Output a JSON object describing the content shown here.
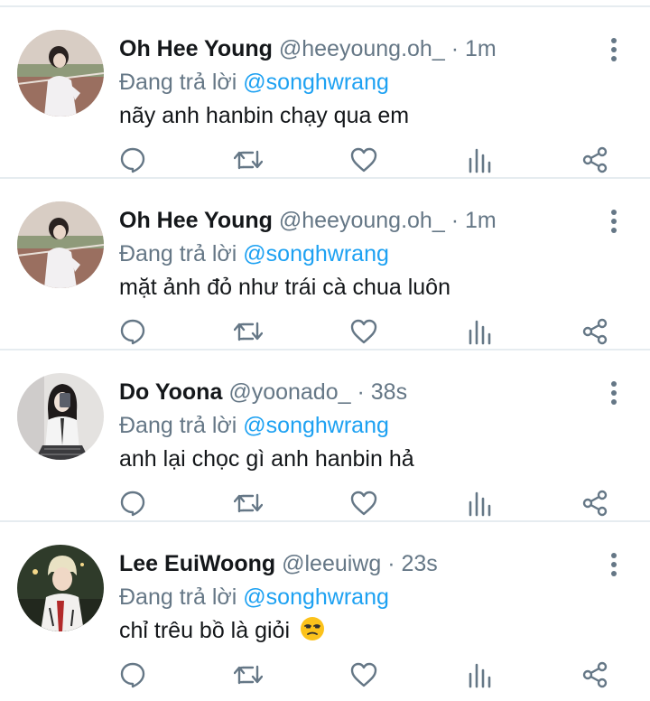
{
  "colors": {
    "text_primary": "#14171a",
    "text_secondary": "#657786",
    "accent": "#1da1f2",
    "icon": "#657786",
    "divider": "#e6ecf0"
  },
  "replies": [
    {
      "name": "Oh Hee Young",
      "handle": "@heeyoung.oh_",
      "separator": "·",
      "time": "1m",
      "reply_prefix": "Đang trả lời",
      "reply_to": "@songhwrang",
      "text": "nãy anh hanbin chạy qua em",
      "avatar_icon": "avatar-photo"
    },
    {
      "name": "Oh Hee Young",
      "handle": "@heeyoung.oh_",
      "separator": "·",
      "time": "1m",
      "reply_prefix": "Đang trả lời",
      "reply_to": "@songhwrang",
      "text": "mặt ảnh đỏ như trái cà chua luôn",
      "avatar_icon": "avatar-photo"
    },
    {
      "name": "Do Yoona",
      "handle": "@yoonado_",
      "separator": "·",
      "time": "38s",
      "reply_prefix": "Đang trả lời",
      "reply_to": "@songhwrang",
      "text": "anh lại chọc gì anh hanbin hả",
      "avatar_icon": "avatar-photo"
    },
    {
      "name": "Lee EuiWoong",
      "handle": "@leeuiwg",
      "separator": "·",
      "time": "23s",
      "reply_prefix": "Đang trả lời",
      "reply_to": "@songhwrang",
      "text": "chỉ trêu bồ là giỏi",
      "emoji": "unamused-face-emoji",
      "avatar_icon": "avatar-photo"
    }
  ],
  "actions": [
    "reply-icon",
    "retweet-icon",
    "like-icon",
    "analytics-icon",
    "share-icon"
  ]
}
